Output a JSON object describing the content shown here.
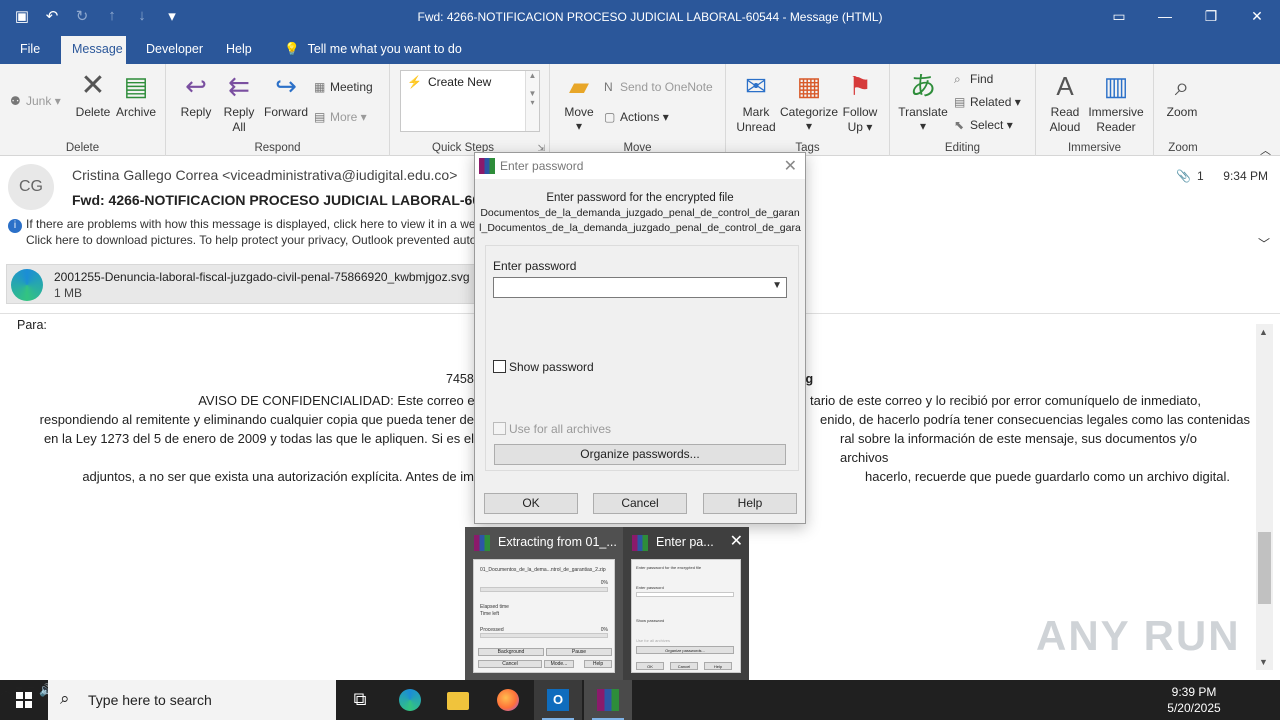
{
  "window": {
    "title": "Fwd: 4266-NOTIFICACION PROCESO JUDICIAL LABORAL-60544  -  Message (HTML)"
  },
  "tabs": [
    "File",
    "Message",
    "Developer",
    "Help"
  ],
  "tell_me": "Tell me what you want to do",
  "ribbon": {
    "delete_group": {
      "junk": "Junk",
      "delete": "Delete",
      "archive": "Archive",
      "label": "Delete"
    },
    "respond_group": {
      "reply": "Reply",
      "reply_all_1": "Reply",
      "reply_all_2": "All",
      "forward": "Forward",
      "meeting": "Meeting",
      "more": "More",
      "label": "Respond"
    },
    "quick_steps": {
      "create_new": "Create New",
      "label": "Quick Steps"
    },
    "move_group": {
      "move": "Move",
      "onenote": "Send to OneNote",
      "actions": "Actions",
      "label": "Move"
    },
    "tags_group": {
      "mark_unread_1": "Mark",
      "mark_unread_2": "Unread",
      "categorize": "Categorize",
      "follow_up_1": "Follow",
      "follow_up_2": "Up",
      "label": "Tags"
    },
    "editing_group": {
      "translate": "Translate",
      "find": "Find",
      "related": "Related",
      "select": "Select",
      "label": "Editing"
    },
    "immersive_group": {
      "read_aloud_1": "Read",
      "read_aloud_2": "Aloud",
      "immersive_reader_1": "Immersive",
      "immersive_reader_2": "Reader",
      "label": "Immersive"
    },
    "zoom_group": {
      "zoom": "Zoom",
      "label": "Zoom"
    }
  },
  "message": {
    "avatar_initials": "CG",
    "from": "Cristina Gallego Correa <viceadministrativa@iudigital.edu.co>",
    "subject": "Fwd: 4266-NOTIFICACION PROCESO JUDICIAL LABORAL-60",
    "info_line_1": "If there are problems with how this message is displayed, click here to view it in a web b",
    "info_line_2": "Click here to download pictures. To help protect your privacy, Outlook prevented autom",
    "attachment_count": "1",
    "time": "9:34 PM",
    "attachment": {
      "name": "2001255-Denuncia-laboral-fiscal-juzgado-civil-penal-75866920_kwbmjgoz.svg",
      "size": "1 MB"
    }
  },
  "body": {
    "para": "Para:",
    "code_left": "7458",
    "code_right": "lg",
    "conf_line_1": "AVISO DE CONFIDENCIALIDAD: Este correo electrónico contiene informa",
    "conf_line_1b": "tario de este correo y lo recibió por error comuníquelo de inmediato,",
    "conf_line_2": "respondiendo al remitente y eliminando cualquier copia que pueda tener de",
    "conf_line_2b": "enido, de hacerlo podría tener consecuencias legales como las contenidas",
    "conf_line_3": "en la Ley 1273 del 5 de enero de 2009 y todas las que le apliquen. Si es el",
    "conf_line_3b": "ral sobre la información de este mensaje, sus documentos y/o archivos",
    "conf_line_4": "adjuntos, a no ser que exista una autorización explícita. Antes de im",
    "conf_line_4b": "hacerlo, recuerde que puede guardarlo como un archivo digital."
  },
  "dialog": {
    "title": "Enter password",
    "prompt": "Enter password for the encrypted file",
    "file_line_1": "Documentos_de_la_demanda_juzgado_penal_de_control_de_garan",
    "file_line_2": "l_Documentos_de_la_demanda_juzgado_penal_de_control_de_gara",
    "field_label": "Enter password",
    "field_value": "",
    "show_password": "Show password",
    "use_all": "Use for all archives",
    "organize": "Organize passwords...",
    "ok": "OK",
    "cancel": "Cancel",
    "help": "Help"
  },
  "thumbnails": {
    "extracting_title": "Extracting from 01_...",
    "enter_title": "Enter pa...",
    "mini_file": "01_Documentos_de_la_dema...ntrol_de_garantias_2.zip",
    "elapsed": "Elapsed time",
    "time_left": "Time left",
    "processed": "Processed",
    "pct": "0%",
    "background": "Background",
    "pause": "Pause",
    "cancel": "Cancel",
    "mode": "Mode...",
    "help": "Help"
  },
  "watermark": "ANY RUN",
  "taskbar": {
    "search_placeholder": "Type here to search",
    "time": "9:39 PM",
    "date": "5/20/2025"
  },
  "colors": {
    "accent": "#2b579a",
    "taskbar": "#202020",
    "ribbon": "#f3f3f3"
  }
}
